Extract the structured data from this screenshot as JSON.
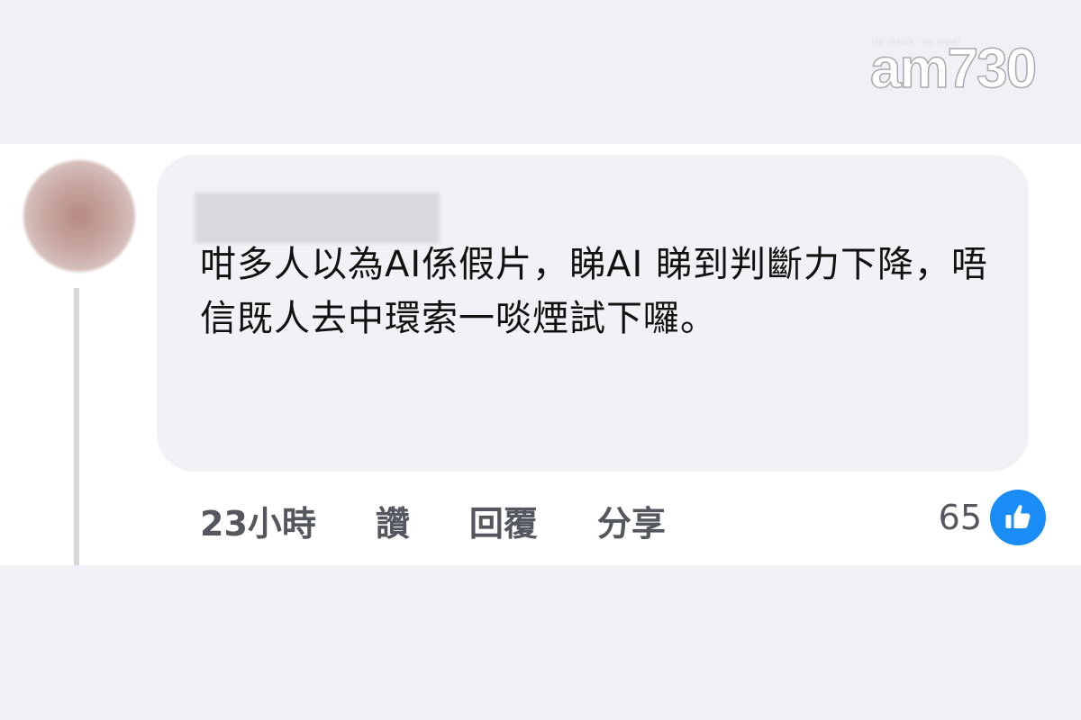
{
  "watermark": {
    "tagline": "my choice · my paper",
    "brand": "am730"
  },
  "comment": {
    "text": "咁多人以為AI係假片，睇AI 睇到判斷力下降，唔信既人去中環索一啖煙試下囉。",
    "time": "23小時",
    "actions": [
      "讚",
      "回覆",
      "分享"
    ],
    "like_count": "65"
  },
  "colors": {
    "like_blue": "#1a8cf6",
    "bubble_bg": "#f0f2f5",
    "action_text": "#54575d"
  },
  "icons": {
    "like": "thumbs-up-icon"
  }
}
